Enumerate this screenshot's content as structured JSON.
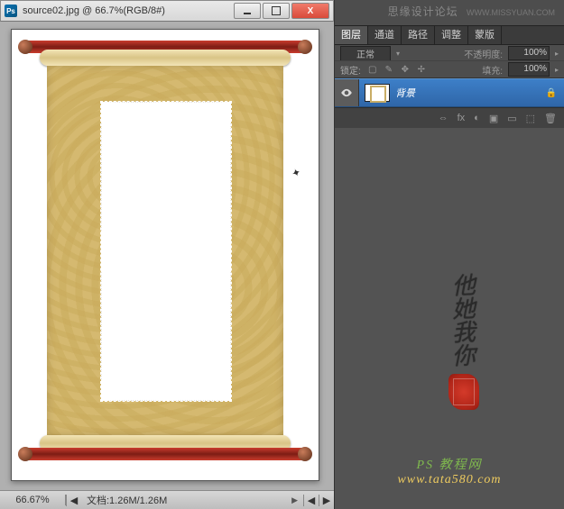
{
  "window": {
    "title": "source02.jpg @ 66.7%(RGB/8#)",
    "buttons": {
      "close_glyph": "X"
    }
  },
  "status": {
    "zoom": "66.67%",
    "doc_info": "文档:1.26M/1.26M",
    "arrow": "▶",
    "left": "◀",
    "right": "▶"
  },
  "header_wm": {
    "zh": "思缘设计论坛",
    "url": "WWW.MISSYUAN.COM"
  },
  "tabs": [
    "图层",
    "通道",
    "路径",
    "调整",
    "蒙版"
  ],
  "active_tab": "图层",
  "options": {
    "blend_mode": "正常",
    "opacity_label": "不透明度:",
    "opacity_value": "100%",
    "lock_label": "锁定:",
    "fill_label": "填充:",
    "fill_value": "100%",
    "lock_icons": [
      "▢",
      "✎",
      "✥",
      "✢"
    ]
  },
  "layer": {
    "name": "背景",
    "lock": "🔒"
  },
  "calligraphy": [
    "他",
    "她",
    "我",
    "你"
  ],
  "footer_wm": {
    "line1": "PS 教程网",
    "line2": "www.tata580.com"
  },
  "panel_footer_icons": [
    "⇔",
    "fx",
    "◐",
    "▣",
    "▭",
    "⬚",
    "🗑"
  ]
}
